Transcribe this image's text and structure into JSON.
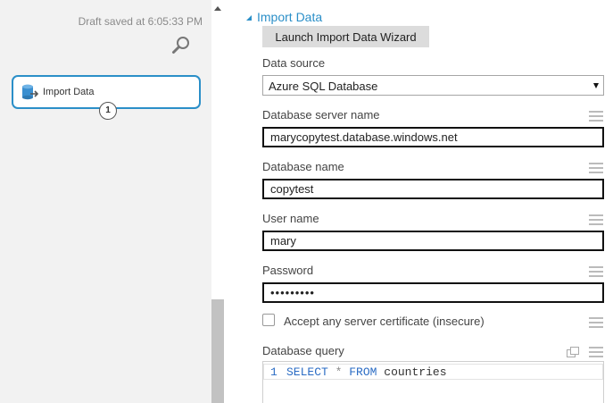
{
  "canvas": {
    "draft_status": "Draft saved at 6:05:33 PM",
    "zoom_icon": "magnifier-icon",
    "module": {
      "icon": "import-data-icon",
      "label": "Import Data",
      "port_number": "1"
    }
  },
  "properties": {
    "section_title": "Import Data",
    "wizard_button_label": "Launch Import Data Wizard",
    "data_source": {
      "label": "Data source",
      "selected": "Azure SQL Database"
    },
    "server_name": {
      "label": "Database server name",
      "value": "marycopytest.database.windows.net"
    },
    "database_name": {
      "label": "Database name",
      "value": "copytest"
    },
    "user_name": {
      "label": "User name",
      "value": "mary"
    },
    "password": {
      "label": "Password",
      "value": "•••••••••"
    },
    "accept_certificate": {
      "label": "Accept any server certificate (insecure)",
      "checked": false
    },
    "query": {
      "label": "Database query",
      "line_number": "1",
      "keyword_select": "SELECT",
      "operator_star": "*",
      "keyword_from": "FROM",
      "table": "countries"
    }
  },
  "colors": {
    "accent": "#2b8fc8",
    "canvas_background": "#f2f2f2",
    "sql_keyword": "#2b6cc4"
  }
}
